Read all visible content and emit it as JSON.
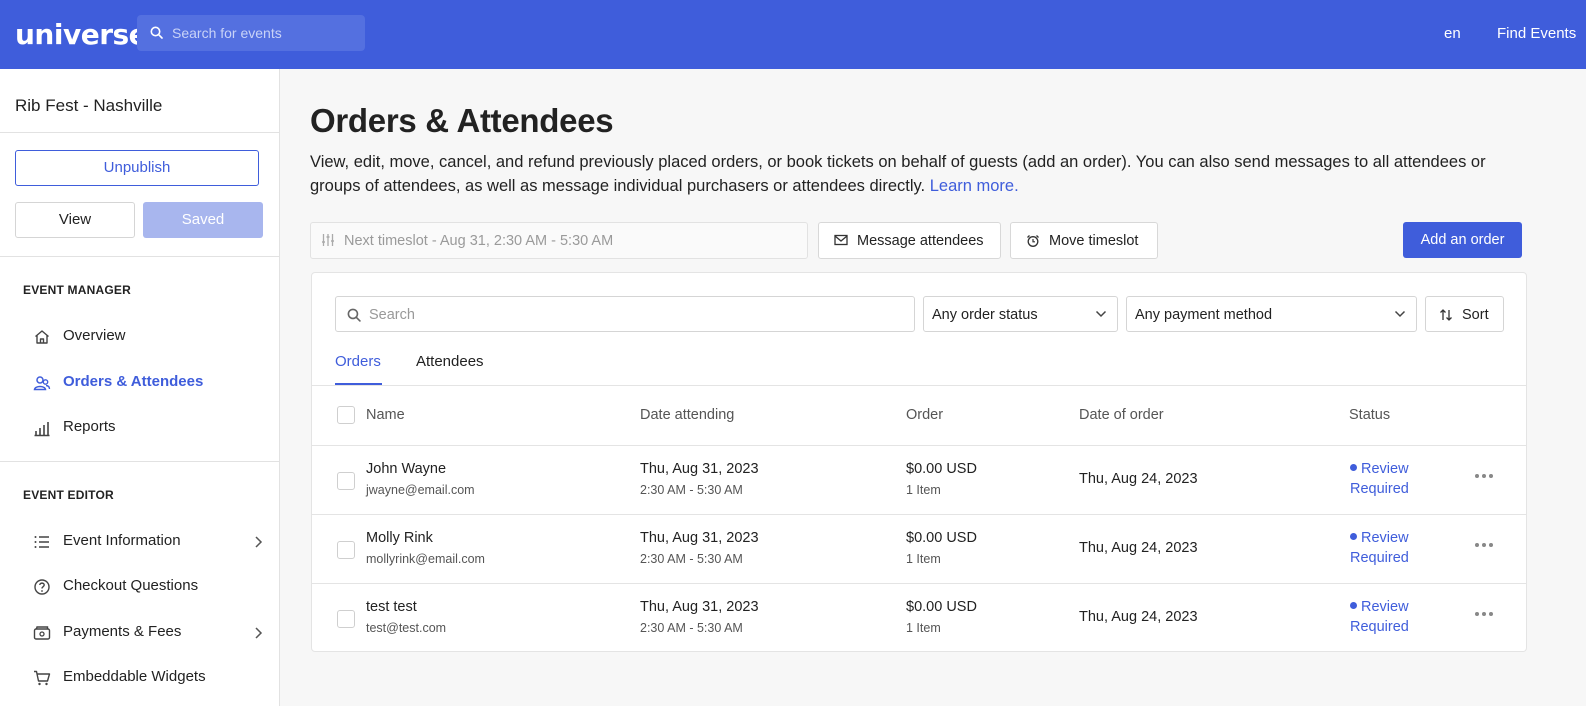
{
  "header": {
    "logo": "universe",
    "search_placeholder": "Search for events",
    "language": "en",
    "find_events": "Find Events"
  },
  "sidebar": {
    "event_name": "Rib Fest - Nashville",
    "unpublish_label": "Unpublish",
    "view_label": "View",
    "saved_label": "Saved",
    "event_manager_title": "EVENT MANAGER",
    "manager_items": [
      {
        "label": "Overview",
        "icon": "home-icon"
      },
      {
        "label": "Orders & Attendees",
        "icon": "users-icon",
        "active": true
      },
      {
        "label": "Reports",
        "icon": "bar-chart-icon"
      }
    ],
    "event_editor_title": "EVENT EDITOR",
    "editor_items": [
      {
        "label": "Event Information",
        "icon": "list-icon",
        "has_submenu": true
      },
      {
        "label": "Checkout Questions",
        "icon": "question-icon"
      },
      {
        "label": "Payments & Fees",
        "icon": "wallet-icon",
        "has_submenu": true
      },
      {
        "label": "Embeddable Widgets",
        "icon": "cart-icon"
      }
    ]
  },
  "main": {
    "title": "Orders & Attendees",
    "description": "View, edit, move, cancel, and refund previously placed orders, or book tickets on behalf of guests (add an order). You can also send messages to all attendees or groups of attendees, as well as message individual purchasers or attendees directly.",
    "learn_more": "Learn more.",
    "timeslot": "Next timeslot - Aug 31, 2:30 AM - 5:30 AM",
    "message_attendees": "Message attendees",
    "move_timeslot": "Move timeslot",
    "add_order": "Add an order"
  },
  "filters": {
    "search_placeholder": "Search",
    "order_status": "Any order status",
    "payment_method": "Any payment method",
    "sort_label": "Sort"
  },
  "tabs": [
    "Orders",
    "Attendees"
  ],
  "table": {
    "columns": [
      "Name",
      "Date attending",
      "Order",
      "Date of order",
      "Status"
    ],
    "rows": [
      {
        "name": "John Wayne",
        "email": "jwayne@email.com",
        "date": "Thu, Aug 31, 2023",
        "time": "2:30 AM - 5:30 AM",
        "amount": "$0.00 USD",
        "items": "1 Item",
        "order_date": "Thu, Aug 24, 2023",
        "status1": "Review",
        "status2": "Required"
      },
      {
        "name": "Molly Rink",
        "email": "mollyrink@email.com",
        "date": "Thu, Aug 31, 2023",
        "time": "2:30 AM - 5:30 AM",
        "amount": "$0.00 USD",
        "items": "1 Item",
        "order_date": "Thu, Aug 24, 2023",
        "status1": "Review",
        "status2": "Required"
      },
      {
        "name": "test test",
        "email": "test@test.com",
        "date": "Thu, Aug 31, 2023",
        "time": "2:30 AM - 5:30 AM",
        "amount": "$0.00 USD",
        "items": "1 Item",
        "order_date": "Thu, Aug 24, 2023",
        "status1": "Review",
        "status2": "Required"
      }
    ]
  },
  "colors": {
    "accent": "#3f5ddb",
    "header_bg": "#3f5ddb",
    "saved_bg": "#a8b6ee"
  }
}
